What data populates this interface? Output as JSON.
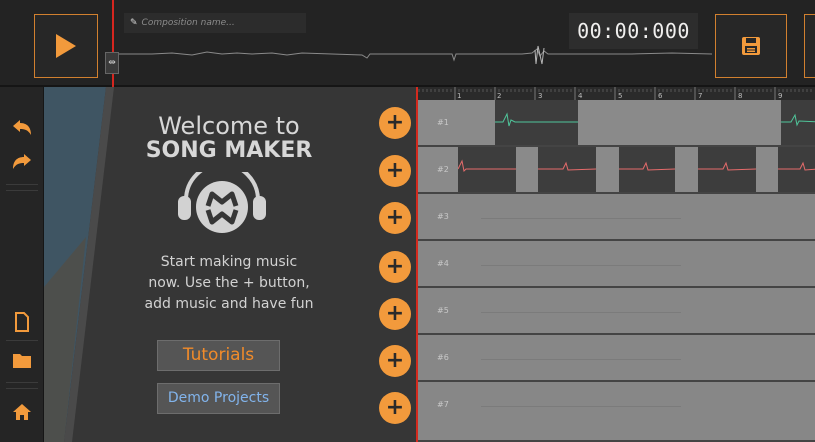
{
  "composition": {
    "placeholder": "Composition name..."
  },
  "time": "00:00:000",
  "welcome": {
    "title": "Welcome to",
    "subtitle": "SONG MAKER",
    "lines": [
      "Start making music",
      "now. Use the + button,",
      "add music and have fun"
    ],
    "tutorials_label": "Tutorials",
    "demo_label": "Demo Projects"
  },
  "ruler": {
    "marks": [
      "1",
      "2",
      "3",
      "4",
      "5",
      "6",
      "7",
      "8",
      "9"
    ]
  },
  "tracks": [
    {
      "label": "#1"
    },
    {
      "label": "#2"
    },
    {
      "label": "#3"
    },
    {
      "label": "#4"
    },
    {
      "label": "#5"
    },
    {
      "label": "#6"
    },
    {
      "label": "#7"
    }
  ],
  "colors": {
    "accent": "#f29a3c",
    "playhead": "#d42a1e",
    "demo_text": "#82b4ec",
    "wave_green": "#4fc59a",
    "wave_red": "#e56b6b"
  },
  "icons": {
    "play": "play-icon",
    "save": "save-icon",
    "undo": "undo-icon",
    "redo": "redo-icon",
    "new_file": "new-file-icon",
    "open_folder": "folder-icon",
    "home": "home-icon",
    "pencil": "pencil-icon",
    "add": "plus-icon"
  }
}
